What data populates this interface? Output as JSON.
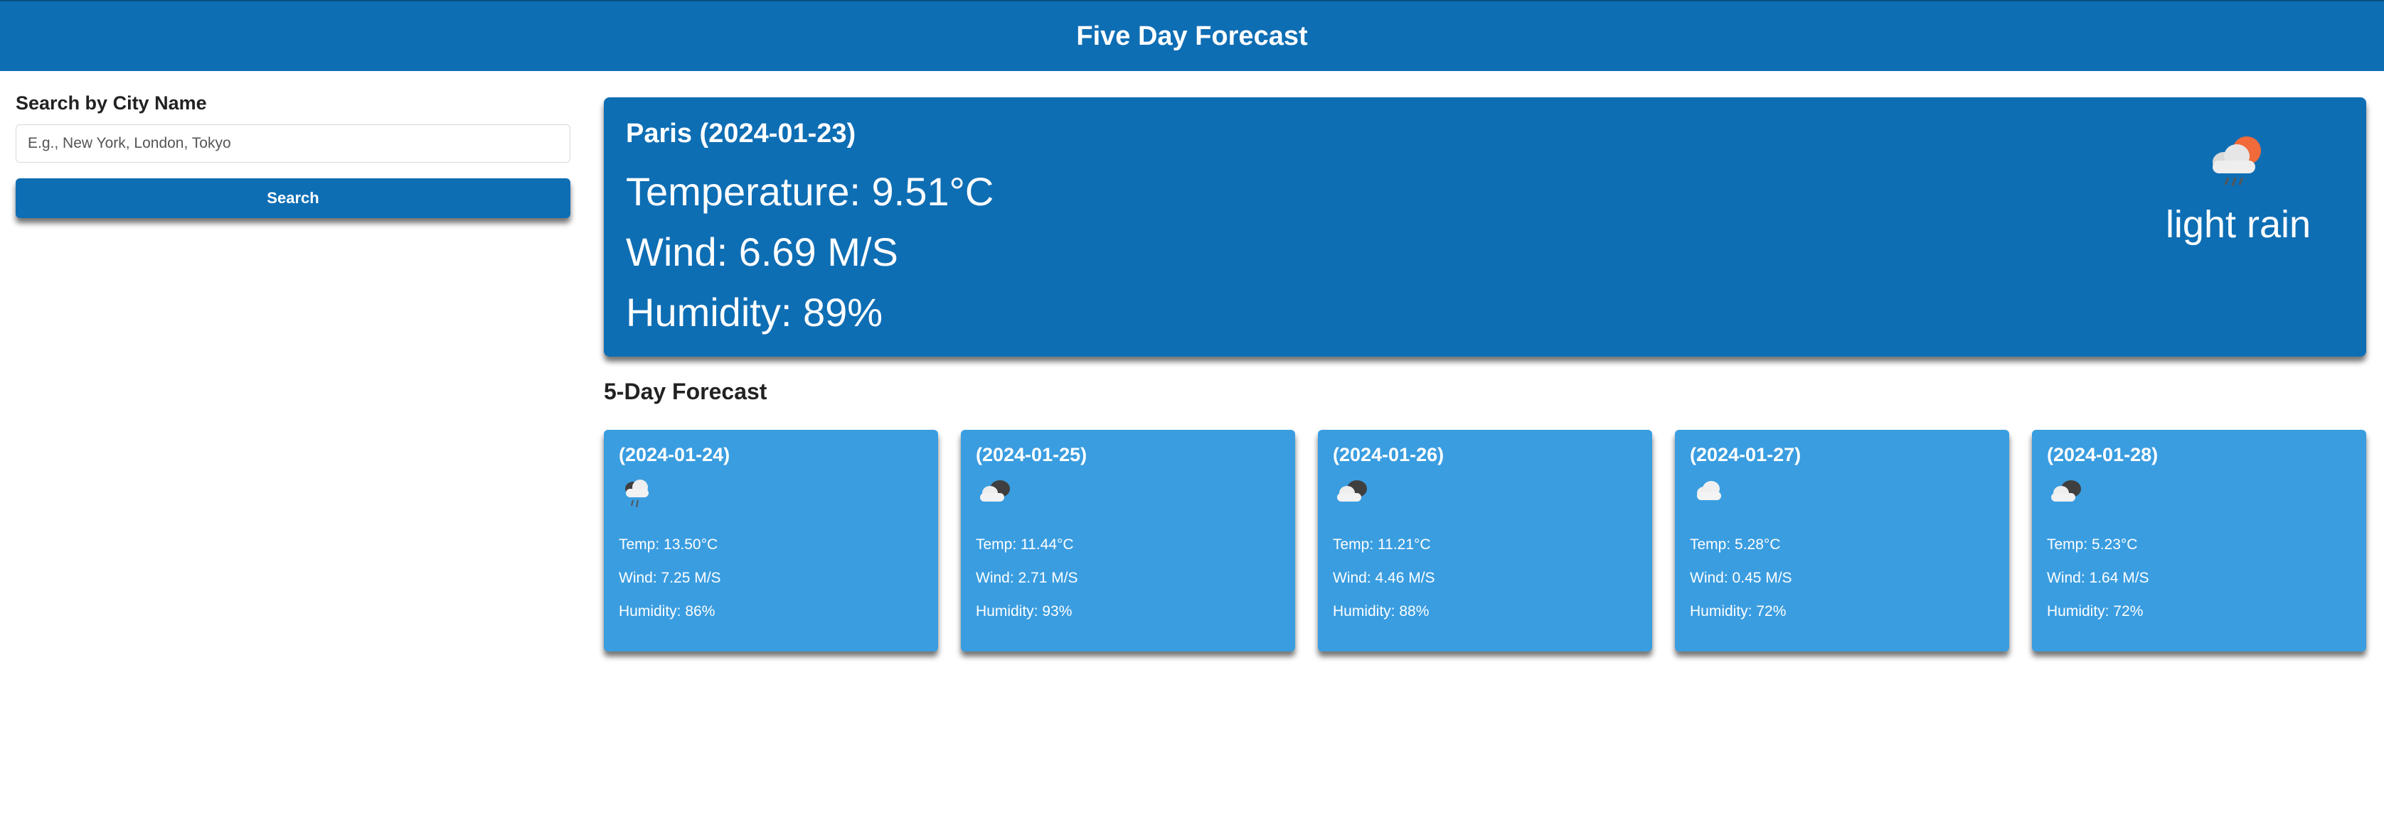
{
  "header": {
    "title": "Five Day Forecast"
  },
  "search": {
    "heading": "Search by City Name",
    "placeholder": "E.g., New York, London, Tokyo",
    "button_label": "Search"
  },
  "current": {
    "city_date": "Paris (2024-01-23)",
    "temperature": "Temperature: 9.51°C",
    "wind": "Wind: 6.69 M/S",
    "humidity": "Humidity: 89%",
    "description": "light rain",
    "icon": "sun-cloud-rain-icon"
  },
  "forecast": {
    "title": "5-Day Forecast",
    "days": [
      {
        "date": "(2024-01-24)",
        "icon": "cloud-rain-icon",
        "temp": "Temp: 13.50°C",
        "wind": "Wind: 7.25 M/S",
        "humidity": "Humidity: 86%"
      },
      {
        "date": "(2024-01-25)",
        "icon": "broken-clouds-icon",
        "temp": "Temp: 11.44°C",
        "wind": "Wind: 2.71 M/S",
        "humidity": "Humidity: 93%"
      },
      {
        "date": "(2024-01-26)",
        "icon": "broken-clouds-icon",
        "temp": "Temp: 11.21°C",
        "wind": "Wind: 4.46 M/S",
        "humidity": "Humidity: 88%"
      },
      {
        "date": "(2024-01-27)",
        "icon": "cloud-icon",
        "temp": "Temp: 5.28°C",
        "wind": "Wind: 0.45 M/S",
        "humidity": "Humidity: 72%"
      },
      {
        "date": "(2024-01-28)",
        "icon": "broken-clouds-icon",
        "temp": "Temp: 5.23°C",
        "wind": "Wind: 1.64 M/S",
        "humidity": "Humidity: 72%"
      }
    ]
  },
  "colors": {
    "header_bg": "#0e6eb4",
    "current_bg": "#0e6eb4",
    "card_bg": "#3a9de0",
    "sun": "#f06a3a"
  }
}
